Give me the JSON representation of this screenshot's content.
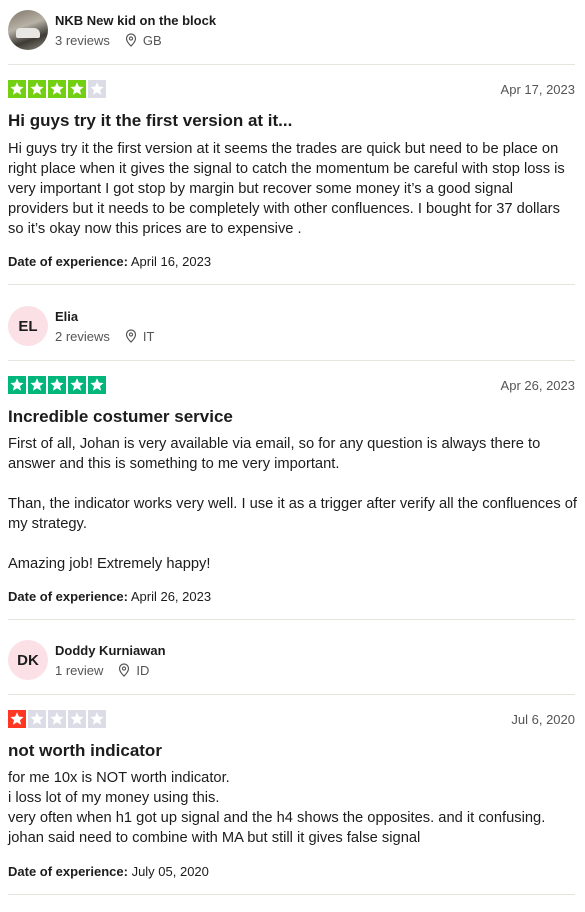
{
  "colors": {
    "star_green": "#00b67a",
    "star_lightgreen": "#73cf11",
    "star_red": "#ff3722",
    "star_empty": "#dcdce6"
  },
  "reviews": [
    {
      "reviewer": {
        "name": "NKB New kid on the block",
        "reviews_count": "3 reviews",
        "country": "GB",
        "avatar_type": "photo"
      },
      "rating": 4,
      "date": "Apr 17, 2023",
      "title": "Hi guys try it the first version at it...",
      "body": "Hi guys try it the first version at it seems the trades are quick but need to be place on right place when it gives the signal to catch the momentum be careful with stop loss is very important I got stop by margin but recover some money it’s a good signal providers but it needs to be completely with other confluences. I bought for 37 dollars so it’s okay now this prices are to expensive .",
      "experience_label": "Date of experience:",
      "experience_date": "April 16, 2023"
    },
    {
      "reviewer": {
        "name": "Elia",
        "initials": "EL",
        "reviews_count": "2 reviews",
        "country": "IT",
        "avatar_type": "initials"
      },
      "rating": 5,
      "date": "Apr 26, 2023",
      "title": "Incredible costumer service",
      "body": "First of all, Johan is very available via email, so for any question is always there to answer and this is something to me very important.\n\nThan, the indicator works very well. I use it as a trigger after verify all the confluences of my strategy.\n\nAmazing job! Extremely happy!",
      "experience_label": "Date of experience:",
      "experience_date": "April 26, 2023"
    },
    {
      "reviewer": {
        "name": "Doddy Kurniawan",
        "initials": "DK",
        "reviews_count": "1 review",
        "country": "ID",
        "avatar_type": "initials"
      },
      "rating": 1,
      "date": "Jul 6, 2020",
      "title": "not worth indicator",
      "body": "for me 10x is NOT worth indicator.\ni loss lot of my money using this.\nvery often when h1 got up signal and the h4 shows the opposites. and it confusing.\njohan said need to combine with MA but still it gives false signal",
      "experience_label": "Date of experience:",
      "experience_date": "July 05, 2020"
    }
  ]
}
